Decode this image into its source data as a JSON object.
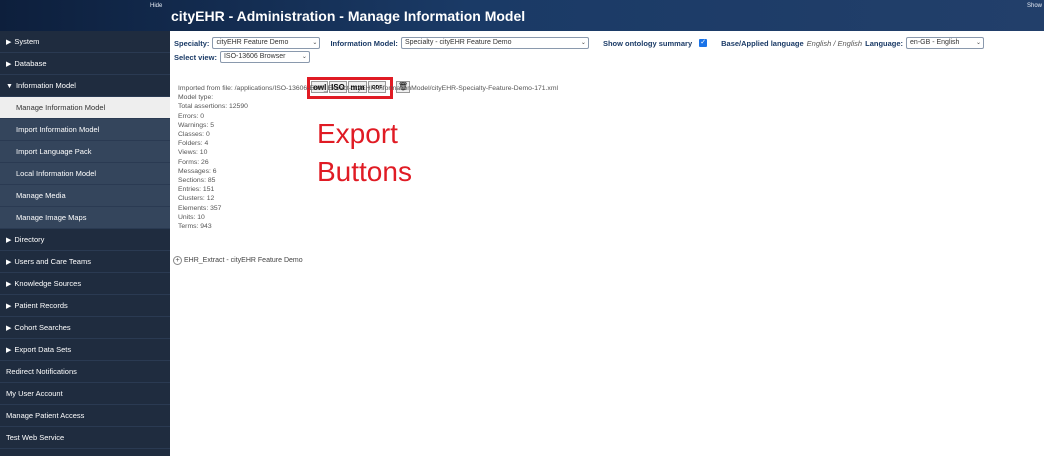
{
  "header": {
    "hide_label": "Hide",
    "title": "cityEHR - Administration - Manage Information Model",
    "show_label": "Show"
  },
  "sidebar": {
    "items": [
      {
        "label": "System",
        "type": "collapsed"
      },
      {
        "label": "Database",
        "type": "collapsed"
      },
      {
        "label": "Information Model",
        "type": "expanded"
      },
      {
        "label": "Manage Information Model",
        "type": "sub-active"
      },
      {
        "label": "Import Information Model",
        "type": "sub"
      },
      {
        "label": "Import Language Pack",
        "type": "sub"
      },
      {
        "label": "Local Information Model",
        "type": "sub"
      },
      {
        "label": "Manage Media",
        "type": "sub"
      },
      {
        "label": "Manage Image Maps",
        "type": "sub"
      },
      {
        "label": "Directory",
        "type": "collapsed"
      },
      {
        "label": "Users and Care Teams",
        "type": "collapsed"
      },
      {
        "label": "Knowledge Sources",
        "type": "collapsed"
      },
      {
        "label": "Patient Records",
        "type": "collapsed"
      },
      {
        "label": "Cohort Searches",
        "type": "collapsed"
      },
      {
        "label": "Export Data Sets",
        "type": "collapsed"
      },
      {
        "label": "Redirect Notifications",
        "type": "plain"
      },
      {
        "label": "My User Account",
        "type": "plain"
      },
      {
        "label": "Manage Patient Access",
        "type": "plain"
      },
      {
        "label": "Test Web Service",
        "type": "plain"
      }
    ]
  },
  "controls": {
    "specialty_label": "Specialty:",
    "specialty_value": "cityEHR Feature Demo",
    "information_model_label": "Information Model:",
    "information_model_value": "Specialty - cityEHR Feature Demo",
    "ontology_label": "Show ontology summary",
    "language_label_1": "Base/Applied language",
    "language_value_1": "English / English",
    "language_label_2": "Language:",
    "language_value": "en-GB - English",
    "view_label": "Select view:",
    "view_value": "ISO-13606 Browser"
  },
  "export_buttons": [
    {
      "label": "owl"
    },
    {
      "label": "ISO"
    },
    {
      "label": "mm"
    },
    {
      "label": "ODF"
    }
  ],
  "annotation": {
    "line1": "Export",
    "line2": "Buttons",
    "color": "#e01b24"
  },
  "summary": [
    "Imported from file: /applications/ISO-13606-EHR_Extract-cityEHR/informationModel/cityEHR-Specialty-Feature-Demo-171.xml",
    "Model type:",
    "Total assertions: 12590",
    "Errors: 0",
    "Warnings: 5",
    "Classes: 0",
    "Folders: 4",
    "Views: 10",
    "Forms: 26",
    "Messages: 6",
    "Sections: 85",
    "Entries: 151",
    "Clusters: 12",
    "Elements: 357",
    "Units: 10",
    "Terms: 943"
  ],
  "tree": {
    "root_label": "EHR_Extract - cityEHR Feature Demo"
  }
}
